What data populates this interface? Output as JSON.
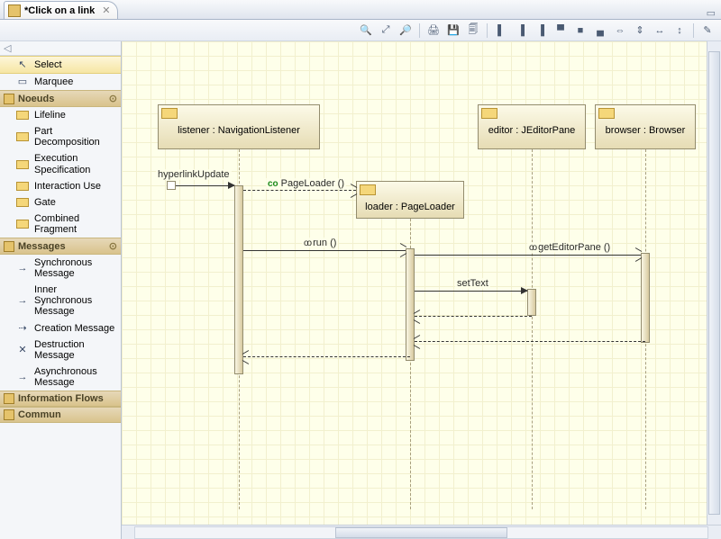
{
  "tab": {
    "title": "*Click on a link"
  },
  "toolbar_icons": [
    "zoom-in",
    "zoom-fit",
    "zoom-out",
    "print",
    "save",
    "copy",
    "align-left",
    "align-center",
    "align-right",
    "align-top",
    "align-middle",
    "align-bottom",
    "dist-h",
    "dist-v",
    "match-w",
    "match-h",
    "brush"
  ],
  "palette": {
    "tools": [
      {
        "label": "Select",
        "icon": "cursor",
        "selected": true
      },
      {
        "label": "Marquee",
        "icon": "marquee"
      }
    ],
    "drawers": [
      {
        "name": "Noeuds",
        "items": [
          {
            "label": "Lifeline"
          },
          {
            "label": "Part Decomposition"
          },
          {
            "label": "Execution Specification"
          },
          {
            "label": "Interaction Use"
          },
          {
            "label": "Gate"
          },
          {
            "label": "Combined Fragment"
          }
        ]
      },
      {
        "name": "Messages",
        "items": [
          {
            "label": "Synchronous Message",
            "arrow": true
          },
          {
            "label": "Inner Synchronous Message",
            "arrow": true
          },
          {
            "label": "Creation Message",
            "arrow": true
          },
          {
            "label": "Destruction Message",
            "arrow": true
          },
          {
            "label": "Asynchronous Message",
            "arrow": true
          }
        ]
      },
      {
        "name": "Information Flows",
        "collapsed": true
      },
      {
        "name": "Commun",
        "collapsed": true
      }
    ]
  },
  "diagram": {
    "lifelines": {
      "listener": {
        "label": "listener : NavigationListener"
      },
      "loader": {
        "label": "loader : PageLoader"
      },
      "editor": {
        "label": "editor : JEditorPane"
      },
      "browser": {
        "label": "browser : Browser"
      }
    },
    "messages": {
      "hyperlink": "hyperlinkUpdate",
      "pageloader": "PageLoader ()",
      "run": "run ()",
      "geteditor": "getEditorPane ()",
      "settext": "setText"
    }
  }
}
